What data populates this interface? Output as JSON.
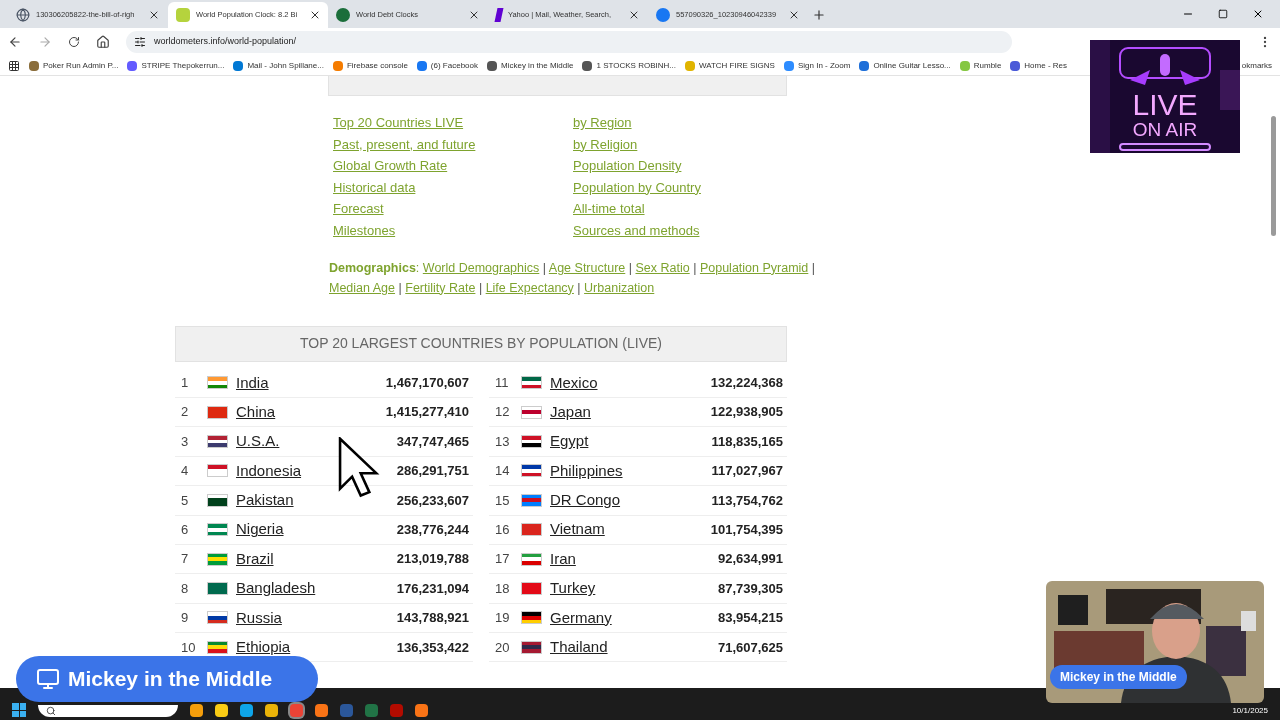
{
  "tabs": [
    {
      "label": "130306205822-the-bill-of-righ",
      "selected": false
    },
    {
      "label": "World Population Clock: 8.2 Bi",
      "selected": true
    },
    {
      "label": "World Debt Clocks",
      "selected": false
    },
    {
      "label": "Yahoo | Mail, Weather, Search,",
      "selected": false
    },
    {
      "label": "557090326_10230946042339",
      "selected": false
    }
  ],
  "address": "worldometers.info/world-population/",
  "bookmarks": [
    {
      "label": "Poker Run Admin P...",
      "color": "#8a6d3b"
    },
    {
      "label": "STRIPE Thepokerrun...",
      "color": "#635bff"
    },
    {
      "label": "Mail - John Spillane...",
      "color": "#0078d4"
    },
    {
      "label": "Firebase console",
      "color": "#f57c00"
    },
    {
      "label": "(6) Facebook",
      "color": "#1877f2"
    },
    {
      "label": "Mickey in the Middle",
      "color": "#555555"
    },
    {
      "label": "1 STOCKS ROBINH...",
      "color": "#555555"
    },
    {
      "label": "WATCH FIRE SIGNS",
      "color": "#e0b400"
    },
    {
      "label": "Sign In - Zoom",
      "color": "#2d8cff"
    },
    {
      "label": "Online Guitar Lesso...",
      "color": "#1e6fd9"
    },
    {
      "label": "Rumble",
      "color": "#85c742"
    },
    {
      "label": "Home - Res",
      "color": "#4a5ad8"
    }
  ],
  "bookmarks_end": "okmarks",
  "sections_left": [
    "Top 20 Countries LIVE",
    "Past, present, and future",
    "Global Growth Rate",
    "Historical data",
    "Forecast",
    "Milestones"
  ],
  "sections_right": [
    "by Region",
    "by Religion",
    "Population Density",
    "Population by Country",
    "All-time total",
    "Sources and methods"
  ],
  "demographics_label": "Demographics",
  "label_separator": ":",
  "demographics_links": [
    "World Demographics",
    "Age Structure",
    "Sex Ratio",
    "Population Pyramid",
    "Median Age",
    "Fertility Rate",
    "Life Expectancy",
    "Urbanization"
  ],
  "separator": "|",
  "table_title": "TOP 20 LARGEST COUNTRIES BY POPULATION (LIVE)",
  "countries": [
    {
      "rank": "1",
      "name": "India",
      "population": "1,467,170,607"
    },
    {
      "rank": "2",
      "name": "China",
      "population": "1,415,277,410"
    },
    {
      "rank": "3",
      "name": "U.S.A.",
      "population": "347,747,465"
    },
    {
      "rank": "4",
      "name": "Indonesia",
      "population": "286,291,751"
    },
    {
      "rank": "5",
      "name": "Pakistan",
      "population": "256,233,607"
    },
    {
      "rank": "6",
      "name": "Nigeria",
      "population": "238,776,244"
    },
    {
      "rank": "7",
      "name": "Brazil",
      "population": "213,019,788"
    },
    {
      "rank": "8",
      "name": "Bangladesh",
      "population": "176,231,094"
    },
    {
      "rank": "9",
      "name": "Russia",
      "population": "143,788,921"
    },
    {
      "rank": "10",
      "name": "Ethiopia",
      "population": "136,353,422"
    },
    {
      "rank": "11",
      "name": "Mexico",
      "population": "132,224,368"
    },
    {
      "rank": "12",
      "name": "Japan",
      "population": "122,938,905"
    },
    {
      "rank": "13",
      "name": "Egypt",
      "population": "118,835,165"
    },
    {
      "rank": "14",
      "name": "Philippines",
      "population": "117,027,967"
    },
    {
      "rank": "15",
      "name": "DR Congo",
      "population": "113,754,762"
    },
    {
      "rank": "16",
      "name": "Vietnam",
      "population": "101,754,395"
    },
    {
      "rank": "17",
      "name": "Iran",
      "population": "92,634,991"
    },
    {
      "rank": "18",
      "name": "Turkey",
      "population": "87,739,305"
    },
    {
      "rank": "19",
      "name": "Germany",
      "population": "83,954,215"
    },
    {
      "rank": "20",
      "name": "Thailand",
      "population": "71,607,625"
    }
  ],
  "live_sign": {
    "line1": "LIVE",
    "line2": "ON AIR"
  },
  "stream_banner": "Mickey in the Middle",
  "webcam_label": "Mickey in the Middle",
  "taskbar": {
    "date": "10/1/2025",
    "apps": [
      {
        "color": "#f59e0b",
        "active": false
      },
      {
        "color": "#facc15",
        "active": false
      },
      {
        "color": "#0ea5e9",
        "active": false
      },
      {
        "color": "#eab308",
        "active": false
      },
      {
        "color": "#ea4335",
        "active": true
      },
      {
        "color": "#f97316",
        "active": false
      },
      {
        "color": "#2b579a",
        "active": false
      },
      {
        "color": "#217346",
        "active": false
      },
      {
        "color": "#b30b00",
        "active": false
      },
      {
        "color": "#f97316",
        "active": false
      }
    ]
  }
}
